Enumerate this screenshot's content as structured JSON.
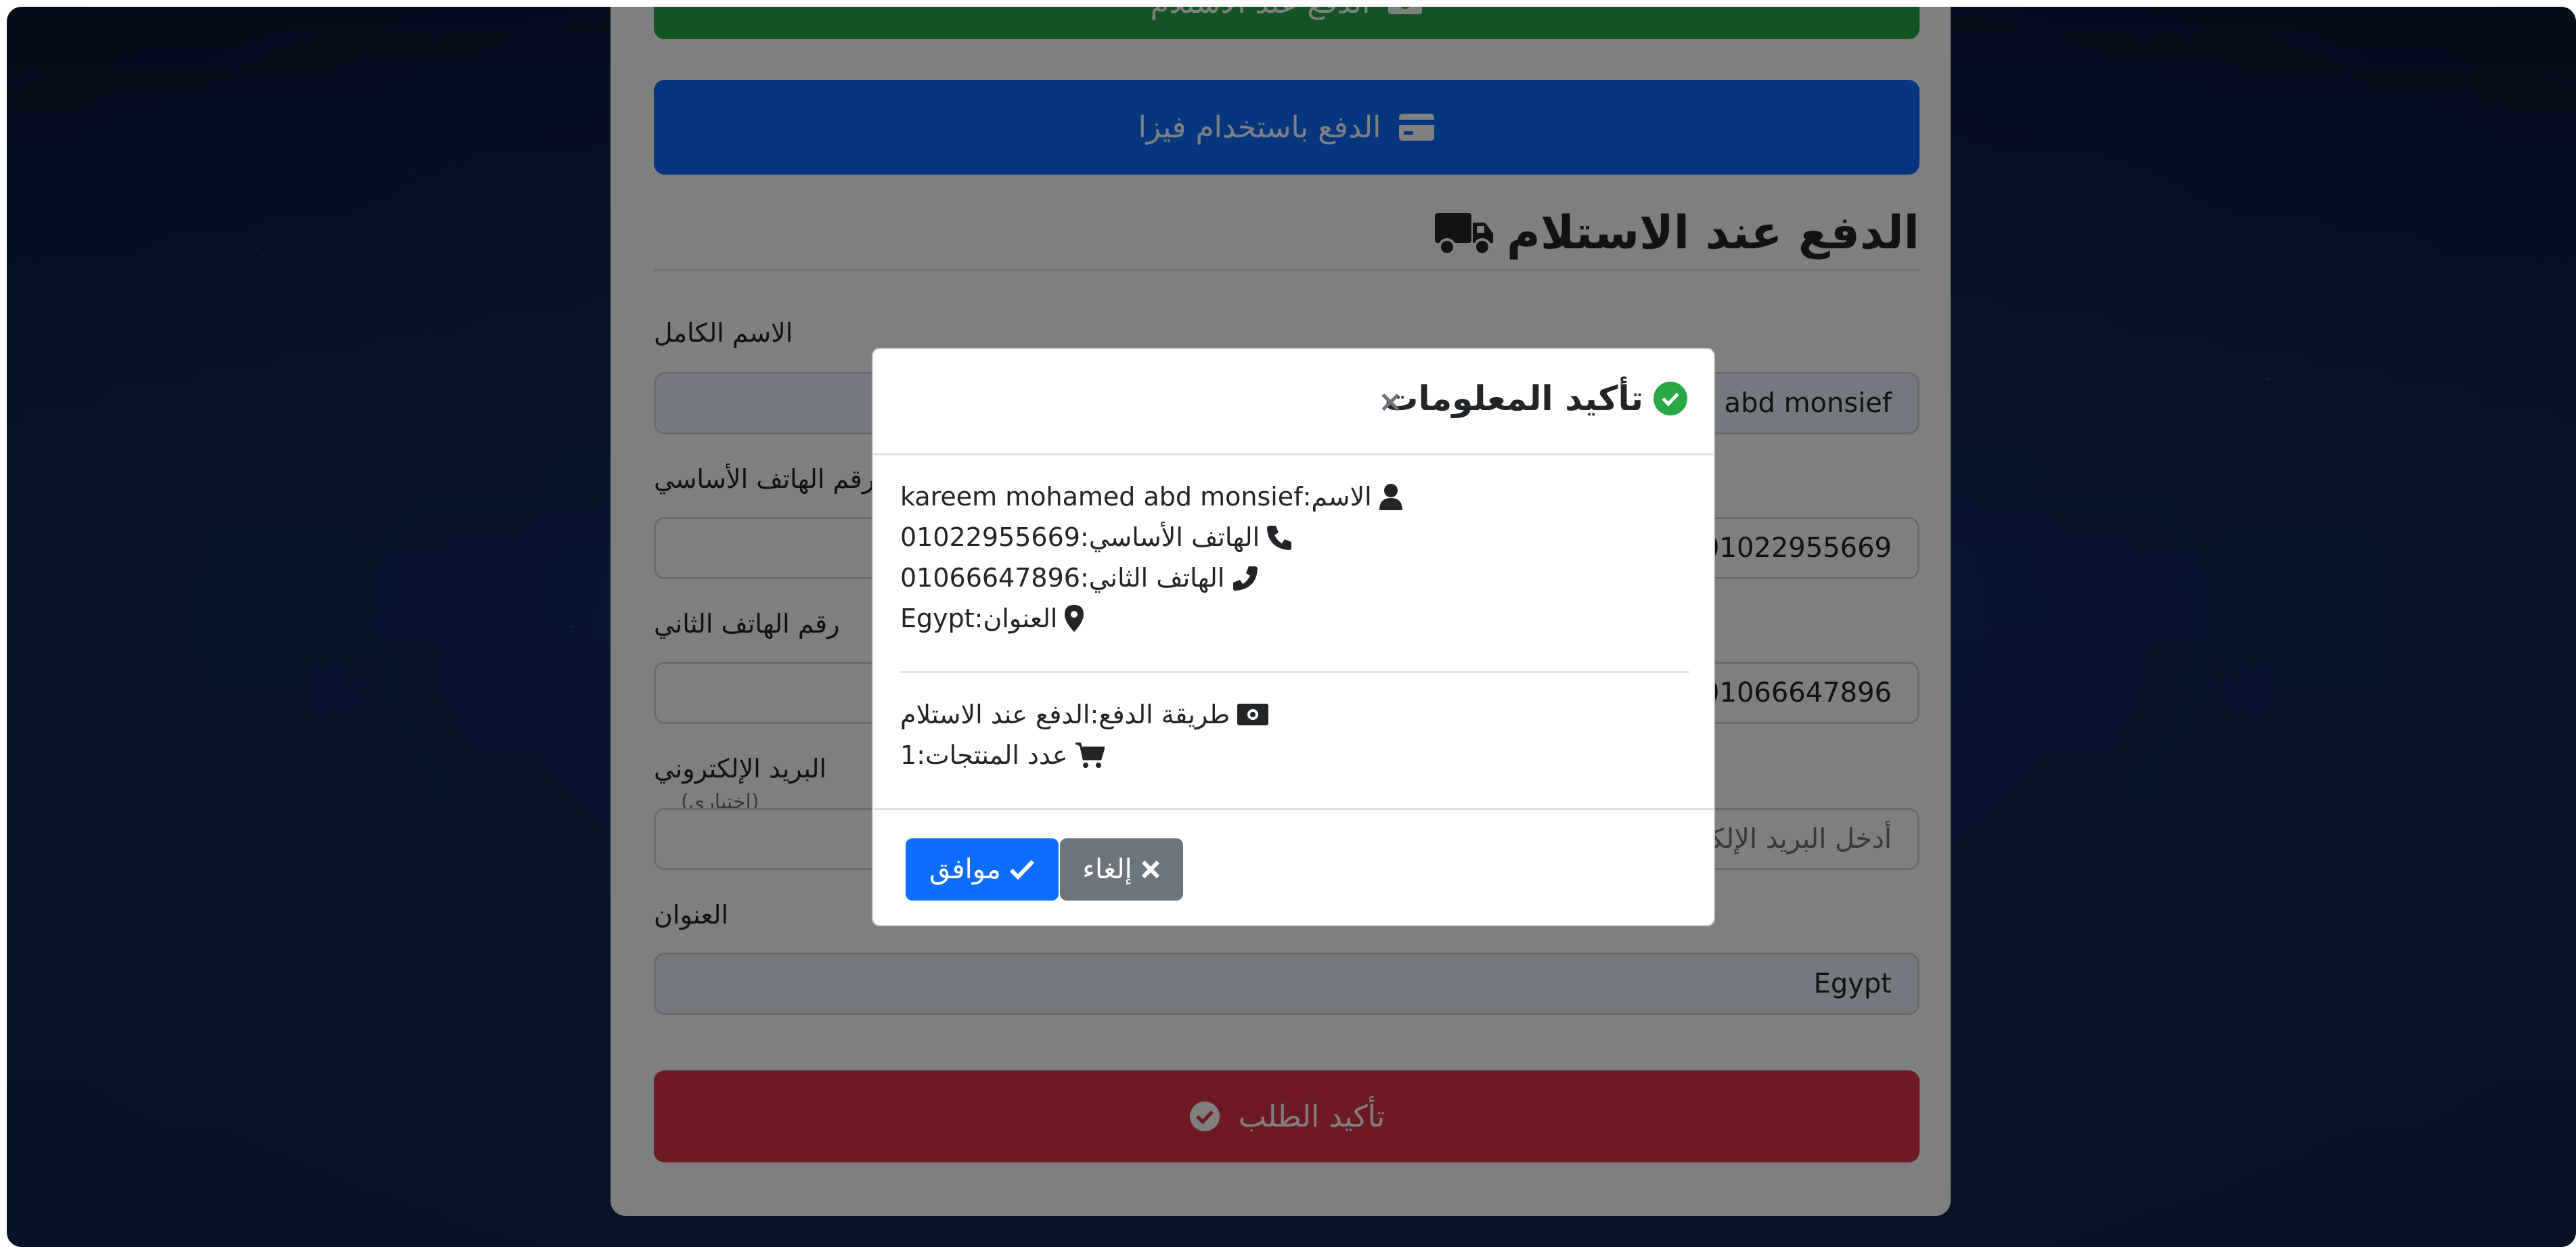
{
  "payment_buttons": {
    "cash_label": "الدفع عند الاستلام",
    "visa_label": "الدفع باستخدام فيزا"
  },
  "section": {
    "title": "الدفع عند الاستلام"
  },
  "form": {
    "full_name": {
      "label": "الاسم الكامل",
      "value": "kareem mohamed abd monsief"
    },
    "phone1": {
      "label": "رقم الهاتف الأساسي",
      "value": "01022955669"
    },
    "phone2": {
      "label": "رقم الهاتف الثاني",
      "value": "01066647896"
    },
    "email": {
      "label": "البريد الإلكتروني",
      "optional": "(اختياري)",
      "placeholder": "أدخل البريد الإلكتروني"
    },
    "address": {
      "label": "العنوان",
      "value": "Egypt"
    },
    "submit_label": "تأكيد الطلب"
  },
  "modal": {
    "title": "تأكيد المعلومات",
    "name_line": "الاسم:kareem mohamed abd monsief",
    "phone1_line": "الهاتف الأساسي:01022955669",
    "phone2_line": "الهاتف الثاني:01066647896",
    "address_line": "العنوان:Egypt",
    "payment_line": "طريقة الدفع:الدفع عند الاستلام",
    "products_line": "عدد المنتجات:1",
    "ok_label": "موافق",
    "cancel_label": "إلغاء"
  },
  "colors": {
    "primary": "#0d6efd",
    "success": "#28a745",
    "danger": "#dc3545",
    "secondary": "#6c757d"
  }
}
